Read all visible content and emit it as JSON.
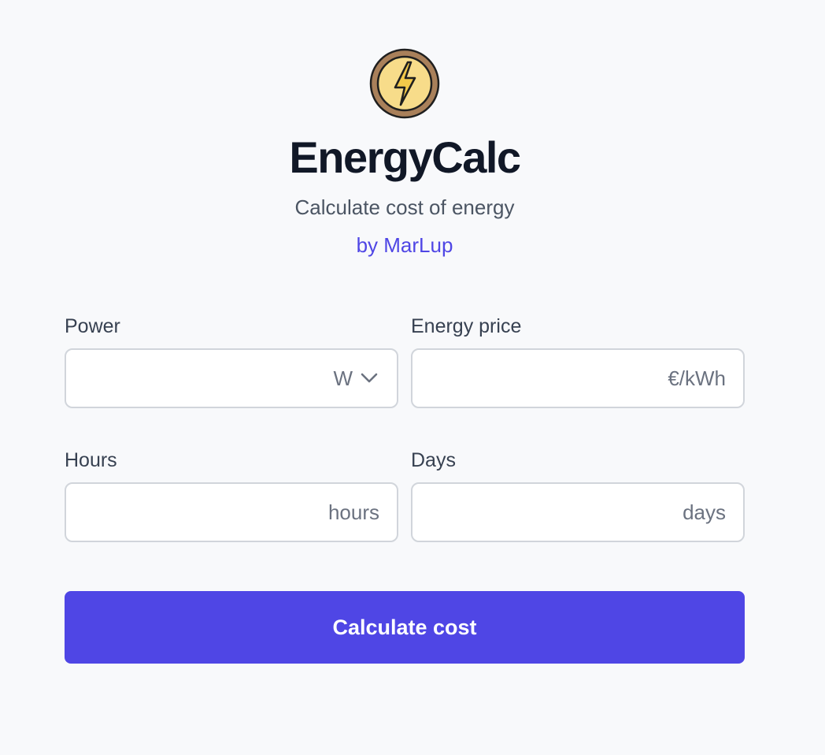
{
  "header": {
    "logo_icon": "lightning-bolt-icon",
    "title": "EnergyCalc",
    "subtitle": "Calculate cost of energy",
    "author": "by MarLup"
  },
  "form": {
    "power": {
      "label": "Power",
      "value": "",
      "unit": "W"
    },
    "energy_price": {
      "label": "Energy price",
      "value": "",
      "unit": "€/kWh"
    },
    "hours": {
      "label": "Hours",
      "value": "",
      "unit": "hours"
    },
    "days": {
      "label": "Days",
      "value": "",
      "unit": "days"
    },
    "submit_label": "Calculate cost"
  },
  "colors": {
    "background": "#f8f9fb",
    "accent": "#4f46e5",
    "title": "#111827",
    "muted": "#6b7280",
    "logo_fill": "#f7dc8a",
    "logo_ring": "#a9805a"
  }
}
